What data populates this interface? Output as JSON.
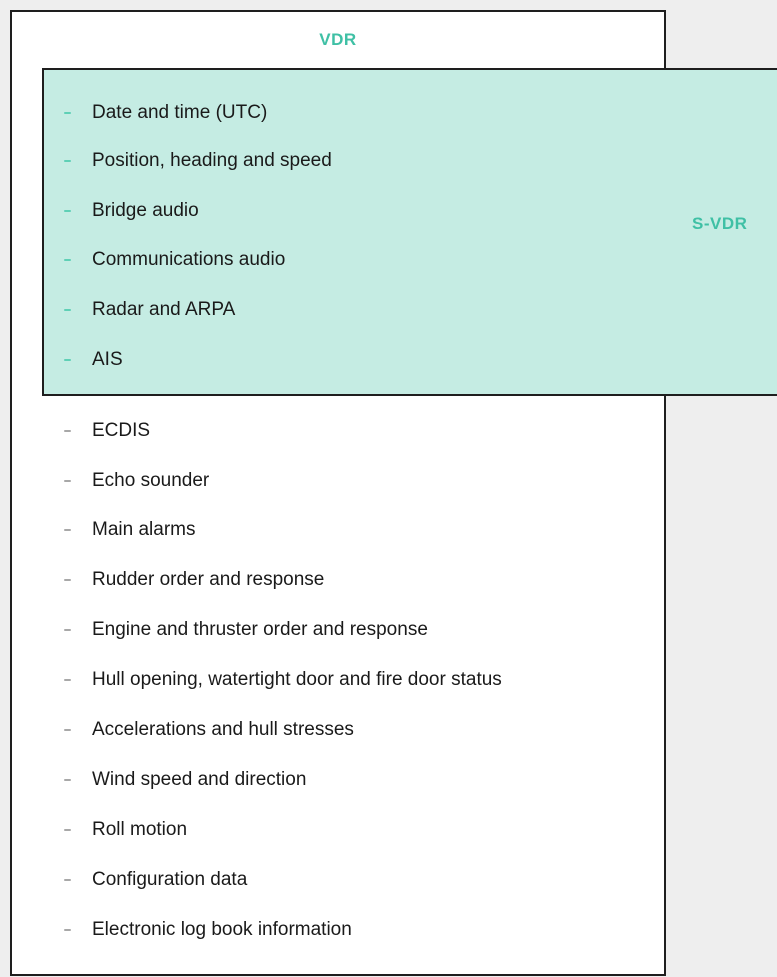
{
  "vdr": {
    "title": "VDR"
  },
  "svdr": {
    "label": "S-VDR"
  },
  "svdr_items": [
    "Date and time (UTC)",
    "Position, heading and speed",
    "Bridge audio",
    "Communications audio",
    "Radar and ARPA",
    "AIS"
  ],
  "vdr_only_items": [
    "ECDIS",
    "Echo sounder",
    "Main alarms",
    "Rudder order and response",
    "Engine and thruster order and response",
    "Hull opening, watertight door and fire door status",
    "Accelerations and hull stresses",
    "Wind speed and direction",
    "Roll motion",
    "Configuration data",
    "Electronic log book information"
  ],
  "colors": {
    "accent": "#3fc0a5",
    "svdr_fill": "#c5ece3",
    "border": "#1e1e1e"
  }
}
